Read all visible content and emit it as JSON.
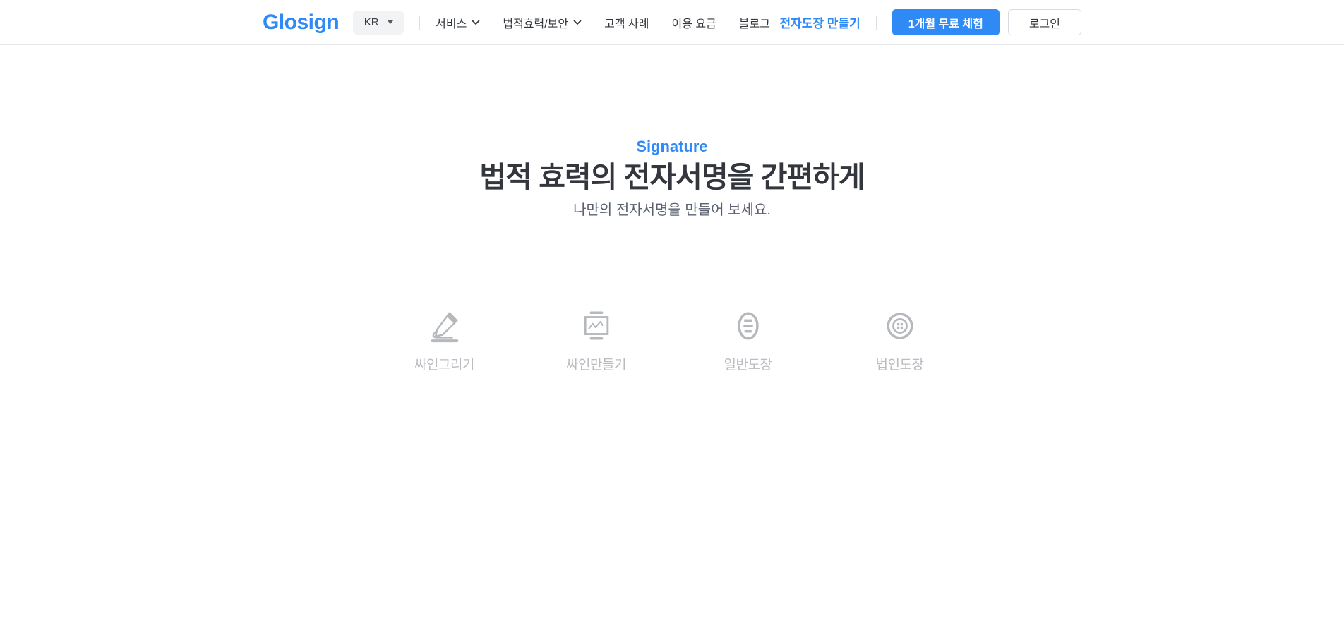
{
  "header": {
    "logo": "Glosign",
    "language": {
      "selected": "KR"
    },
    "nav": [
      {
        "label": "서비스",
        "has_dropdown": true
      },
      {
        "label": "법적효력/보안",
        "has_dropdown": true
      },
      {
        "label": "고객 사례",
        "has_dropdown": false
      },
      {
        "label": "이용 요금",
        "has_dropdown": false
      },
      {
        "label": "블로그",
        "has_dropdown": false
      }
    ],
    "actions": {
      "stamp_link": "전자도장 만들기",
      "trial_button": "1개월 무료 체험",
      "login_button": "로그인"
    }
  },
  "hero": {
    "eyebrow": "Signature",
    "title": "법적 효력의 전자서명을 간편하게",
    "subtitle": "나만의 전자서명을 만들어 보세요."
  },
  "options": [
    {
      "label": "싸인그리기",
      "icon": "pencil-sign-icon"
    },
    {
      "label": "싸인만들기",
      "icon": "monitor-sign-icon"
    },
    {
      "label": "일반도장",
      "icon": "oval-stamp-icon"
    },
    {
      "label": "법인도장",
      "icon": "round-stamp-icon"
    }
  ],
  "colors": {
    "accent": "#2f8af5",
    "text_dark": "#33373d",
    "icon_gray": "#b5b8bc",
    "caption_gray": "#b9bcc0",
    "border": "#e4e6e8"
  }
}
